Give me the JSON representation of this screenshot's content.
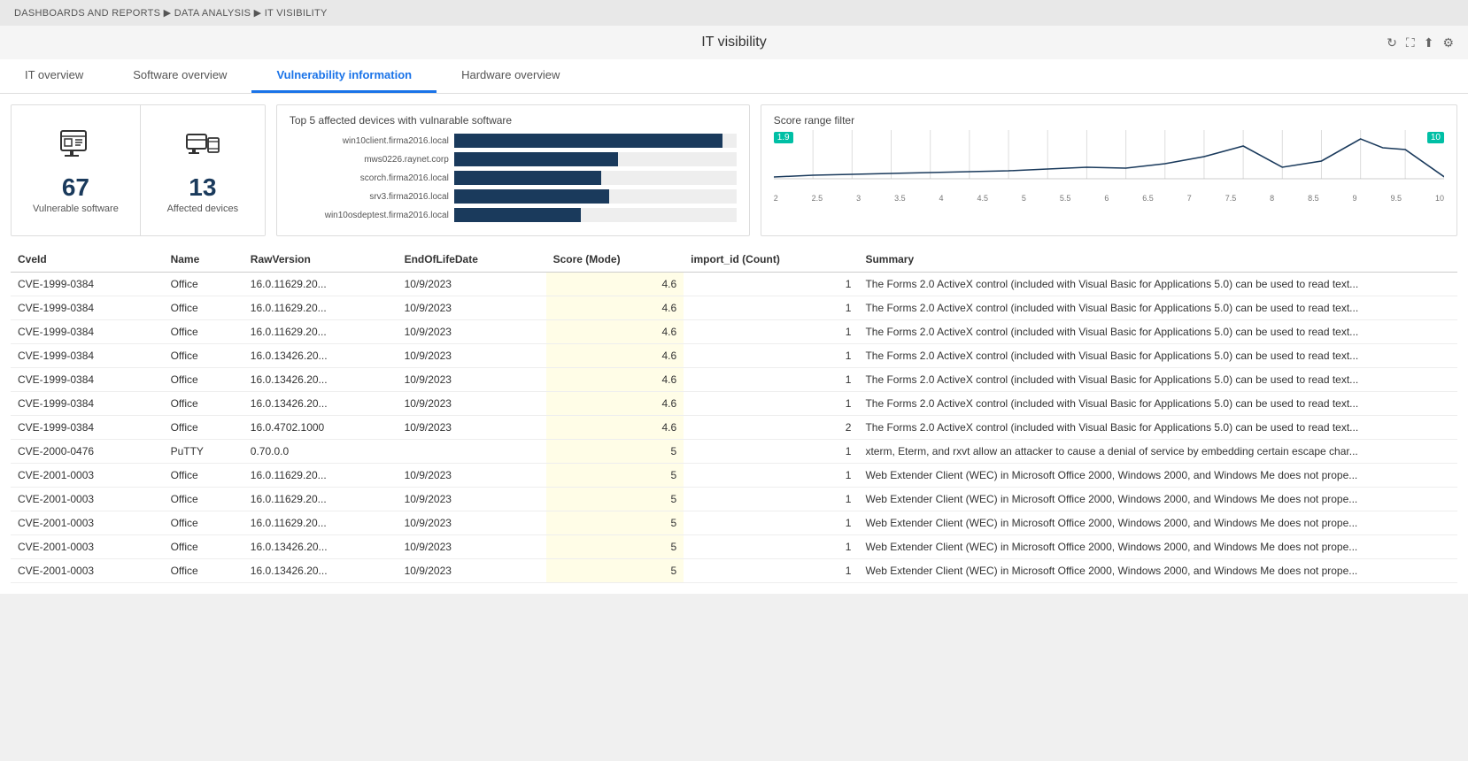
{
  "breadcrumb": "DASHBOARDS AND REPORTS ▶ DATA ANALYSIS ▶ IT VISIBILITY",
  "page": {
    "title": "IT visibility"
  },
  "toolbar": {
    "icons": [
      "↻",
      "⛶",
      "⬆",
      "⚙"
    ]
  },
  "tabs": [
    {
      "label": "IT overview",
      "active": false
    },
    {
      "label": "Software overview",
      "active": false
    },
    {
      "label": "Vulnerability information",
      "active": true
    },
    {
      "label": "Hardware overview",
      "active": false
    }
  ],
  "stat_cards": [
    {
      "number": "67",
      "label": "Vulnerable software",
      "icon": "software"
    },
    {
      "number": "13",
      "label": "Affected devices",
      "icon": "devices"
    }
  ],
  "bar_chart": {
    "title": "Top 5 affected devices with vulnarable software",
    "bars": [
      {
        "label": "win10client.firma2016.local",
        "value": 95
      },
      {
        "label": "mws0226.raynet.corp",
        "value": 58
      },
      {
        "label": "scorch.firma2016.local",
        "value": 52
      },
      {
        "label": "srv3.firma2016.local",
        "value": 55
      },
      {
        "label": "win10osdeptest.firma2016.local",
        "value": 45
      }
    ]
  },
  "score_range": {
    "title": "Score range filter",
    "min_badge": "1.9",
    "max_badge": "10",
    "x_labels": [
      "2",
      "2.5",
      "3",
      "3.5",
      "4",
      "4.5",
      "5",
      "5.5",
      "6",
      "6.5",
      "7",
      "7.5",
      "8",
      "8.5",
      "9",
      "9.5",
      "10"
    ]
  },
  "table": {
    "columns": [
      "CveId",
      "Name",
      "RawVersion",
      "EndOfLifeDate",
      "Score (Mode)",
      "import_id (Count)",
      "Summary"
    ],
    "rows": [
      {
        "cveId": "CVE-1999-0384",
        "name": "Office",
        "rawVersion": "16.0.11629.20...",
        "endOfLife": "10/9/2023",
        "score": 4.6,
        "count": 1,
        "summary": "The Forms 2.0 ActiveX control (included with Visual Basic for Applications 5.0) can be used to read text..."
      },
      {
        "cveId": "CVE-1999-0384",
        "name": "Office",
        "rawVersion": "16.0.11629.20...",
        "endOfLife": "10/9/2023",
        "score": 4.6,
        "count": 1,
        "summary": "The Forms 2.0 ActiveX control (included with Visual Basic for Applications 5.0) can be used to read text..."
      },
      {
        "cveId": "CVE-1999-0384",
        "name": "Office",
        "rawVersion": "16.0.11629.20...",
        "endOfLife": "10/9/2023",
        "score": 4.6,
        "count": 1,
        "summary": "The Forms 2.0 ActiveX control (included with Visual Basic for Applications 5.0) can be used to read text..."
      },
      {
        "cveId": "CVE-1999-0384",
        "name": "Office",
        "rawVersion": "16.0.13426.20...",
        "endOfLife": "10/9/2023",
        "score": 4.6,
        "count": 1,
        "summary": "The Forms 2.0 ActiveX control (included with Visual Basic for Applications 5.0) can be used to read text..."
      },
      {
        "cveId": "CVE-1999-0384",
        "name": "Office",
        "rawVersion": "16.0.13426.20...",
        "endOfLife": "10/9/2023",
        "score": 4.6,
        "count": 1,
        "summary": "The Forms 2.0 ActiveX control (included with Visual Basic for Applications 5.0) can be used to read text..."
      },
      {
        "cveId": "CVE-1999-0384",
        "name": "Office",
        "rawVersion": "16.0.13426.20...",
        "endOfLife": "10/9/2023",
        "score": 4.6,
        "count": 1,
        "summary": "The Forms 2.0 ActiveX control (included with Visual Basic for Applications 5.0) can be used to read text..."
      },
      {
        "cveId": "CVE-1999-0384",
        "name": "Office",
        "rawVersion": "16.0.4702.1000",
        "endOfLife": "10/9/2023",
        "score": 4.6,
        "count": 2,
        "summary": "The Forms 2.0 ActiveX control (included with Visual Basic for Applications 5.0) can be used to read text..."
      },
      {
        "cveId": "CVE-2000-0476",
        "name": "PuTTY",
        "rawVersion": "0.70.0.0",
        "endOfLife": "",
        "score": 5,
        "count": 1,
        "summary": "xterm, Eterm, and rxvt allow an attacker to cause a denial of service by embedding certain escape char..."
      },
      {
        "cveId": "CVE-2001-0003",
        "name": "Office",
        "rawVersion": "16.0.11629.20...",
        "endOfLife": "10/9/2023",
        "score": 5,
        "count": 1,
        "summary": "Web Extender Client (WEC) in Microsoft Office 2000, Windows 2000, and Windows Me does not prope..."
      },
      {
        "cveId": "CVE-2001-0003",
        "name": "Office",
        "rawVersion": "16.0.11629.20...",
        "endOfLife": "10/9/2023",
        "score": 5,
        "count": 1,
        "summary": "Web Extender Client (WEC) in Microsoft Office 2000, Windows 2000, and Windows Me does not prope..."
      },
      {
        "cveId": "CVE-2001-0003",
        "name": "Office",
        "rawVersion": "16.0.11629.20...",
        "endOfLife": "10/9/2023",
        "score": 5,
        "count": 1,
        "summary": "Web Extender Client (WEC) in Microsoft Office 2000, Windows 2000, and Windows Me does not prope..."
      },
      {
        "cveId": "CVE-2001-0003",
        "name": "Office",
        "rawVersion": "16.0.13426.20...",
        "endOfLife": "10/9/2023",
        "score": 5,
        "count": 1,
        "summary": "Web Extender Client (WEC) in Microsoft Office 2000, Windows 2000, and Windows Me does not prope..."
      },
      {
        "cveId": "CVE-2001-0003",
        "name": "Office",
        "rawVersion": "16.0.13426.20...",
        "endOfLife": "10/9/2023",
        "score": 5,
        "count": 1,
        "summary": "Web Extender Client (WEC) in Microsoft Office 2000, Windows 2000, and Windows Me does not prope..."
      }
    ]
  }
}
